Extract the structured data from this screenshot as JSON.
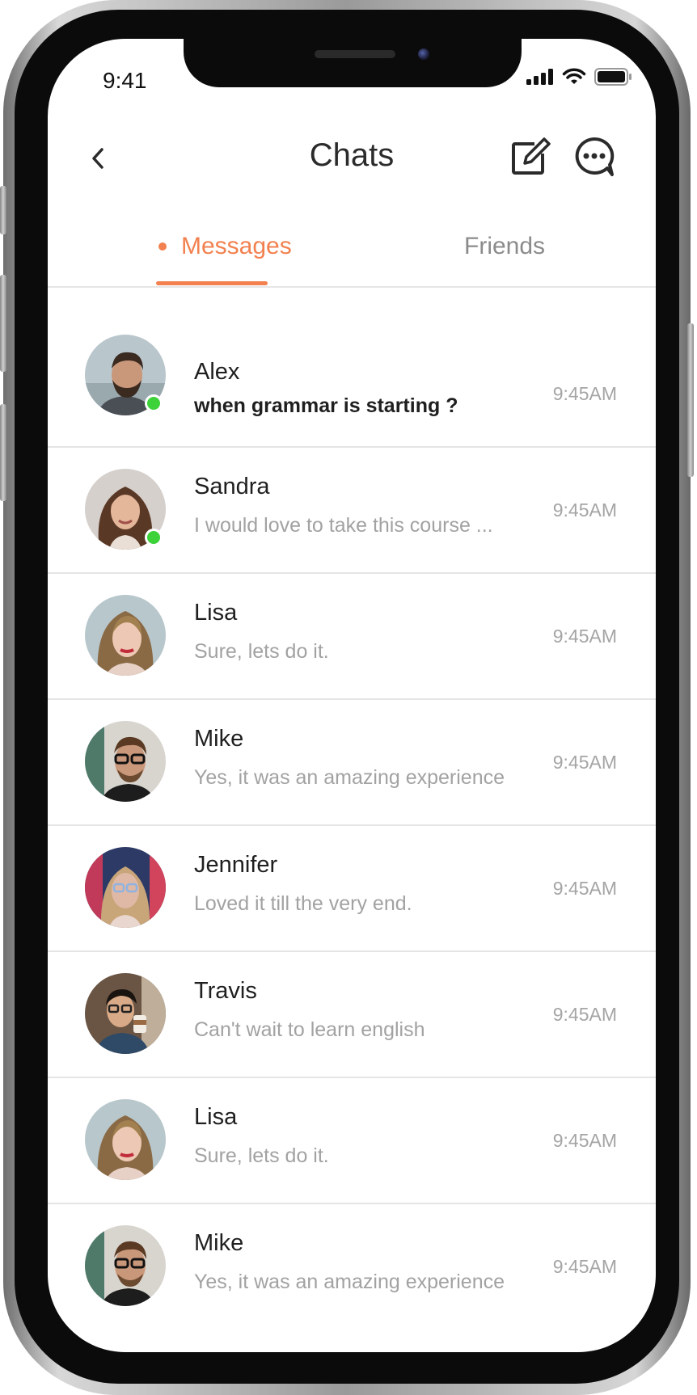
{
  "status_bar": {
    "time": "9:41"
  },
  "header": {
    "title": "Chats",
    "back_icon": "chevron-left-icon",
    "compose_icon": "compose-icon",
    "chat_icon": "chat-bubble-icon"
  },
  "tabs": [
    {
      "label": "Messages",
      "active": true
    },
    {
      "label": "Friends",
      "active": false
    }
  ],
  "colors": {
    "accent": "#f2814f",
    "online": "#3dd23a",
    "divider": "#e5e5e5",
    "muted_text": "#a2a2a2"
  },
  "chats": [
    {
      "name": "Alex",
      "message": "when grammar is starting ?",
      "time": "9:45AM",
      "online": true,
      "unread": true
    },
    {
      "name": "Sandra",
      "message": "I would love to take this course ...",
      "time": "9:45AM",
      "online": true,
      "unread": false
    },
    {
      "name": "Lisa",
      "message": "Sure, lets do it.",
      "time": "9:45AM",
      "online": false,
      "unread": false
    },
    {
      "name": "Mike",
      "message": "Yes, it was an amazing experience",
      "time": "9:45AM",
      "online": false,
      "unread": false
    },
    {
      "name": "Jennifer",
      "message": "Loved it till the very end.",
      "time": "9:45AM",
      "online": false,
      "unread": false
    },
    {
      "name": "Travis",
      "message": "Can't wait to learn english",
      "time": "9:45AM",
      "online": false,
      "unread": false
    },
    {
      "name": "Lisa",
      "message": "Sure, lets do it.",
      "time": "9:45AM",
      "online": false,
      "unread": false
    },
    {
      "name": "Mike",
      "message": "Yes, it was an amazing experience",
      "time": "9:45AM",
      "online": false,
      "unread": false
    }
  ]
}
